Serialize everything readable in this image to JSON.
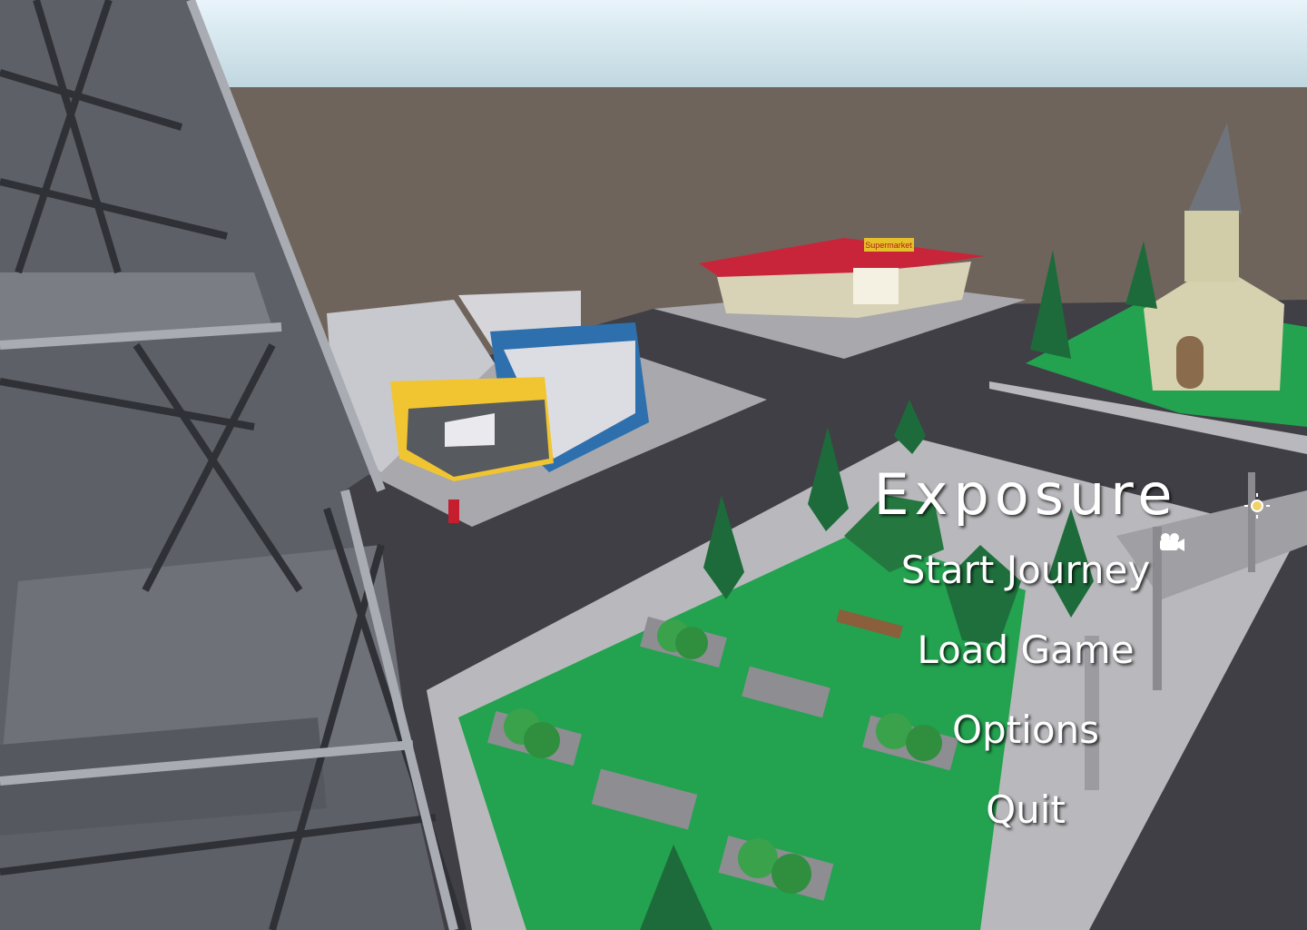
{
  "game": {
    "title": "Exposure"
  },
  "menu": {
    "items": [
      {
        "label": "Start Journey"
      },
      {
        "label": "Load Game"
      },
      {
        "label": "Options"
      },
      {
        "label": "Quit"
      }
    ]
  },
  "scene": {
    "store_sign": "Supermarket",
    "icons": [
      "sun-gizmo-icon",
      "camera-gizmo-icon"
    ],
    "colors": {
      "sky": "#cfe3ec",
      "ground": "#6f645b",
      "road": "#3f3f45",
      "grass": "#23a24f",
      "sidewalk": "#b9b9bd",
      "tower": "#5d6066",
      "tree": "#1d6b3a",
      "supermarket_roof": "#c9253a",
      "building_blue": "#2e6fae",
      "building_yellow": "#f1c531"
    }
  }
}
